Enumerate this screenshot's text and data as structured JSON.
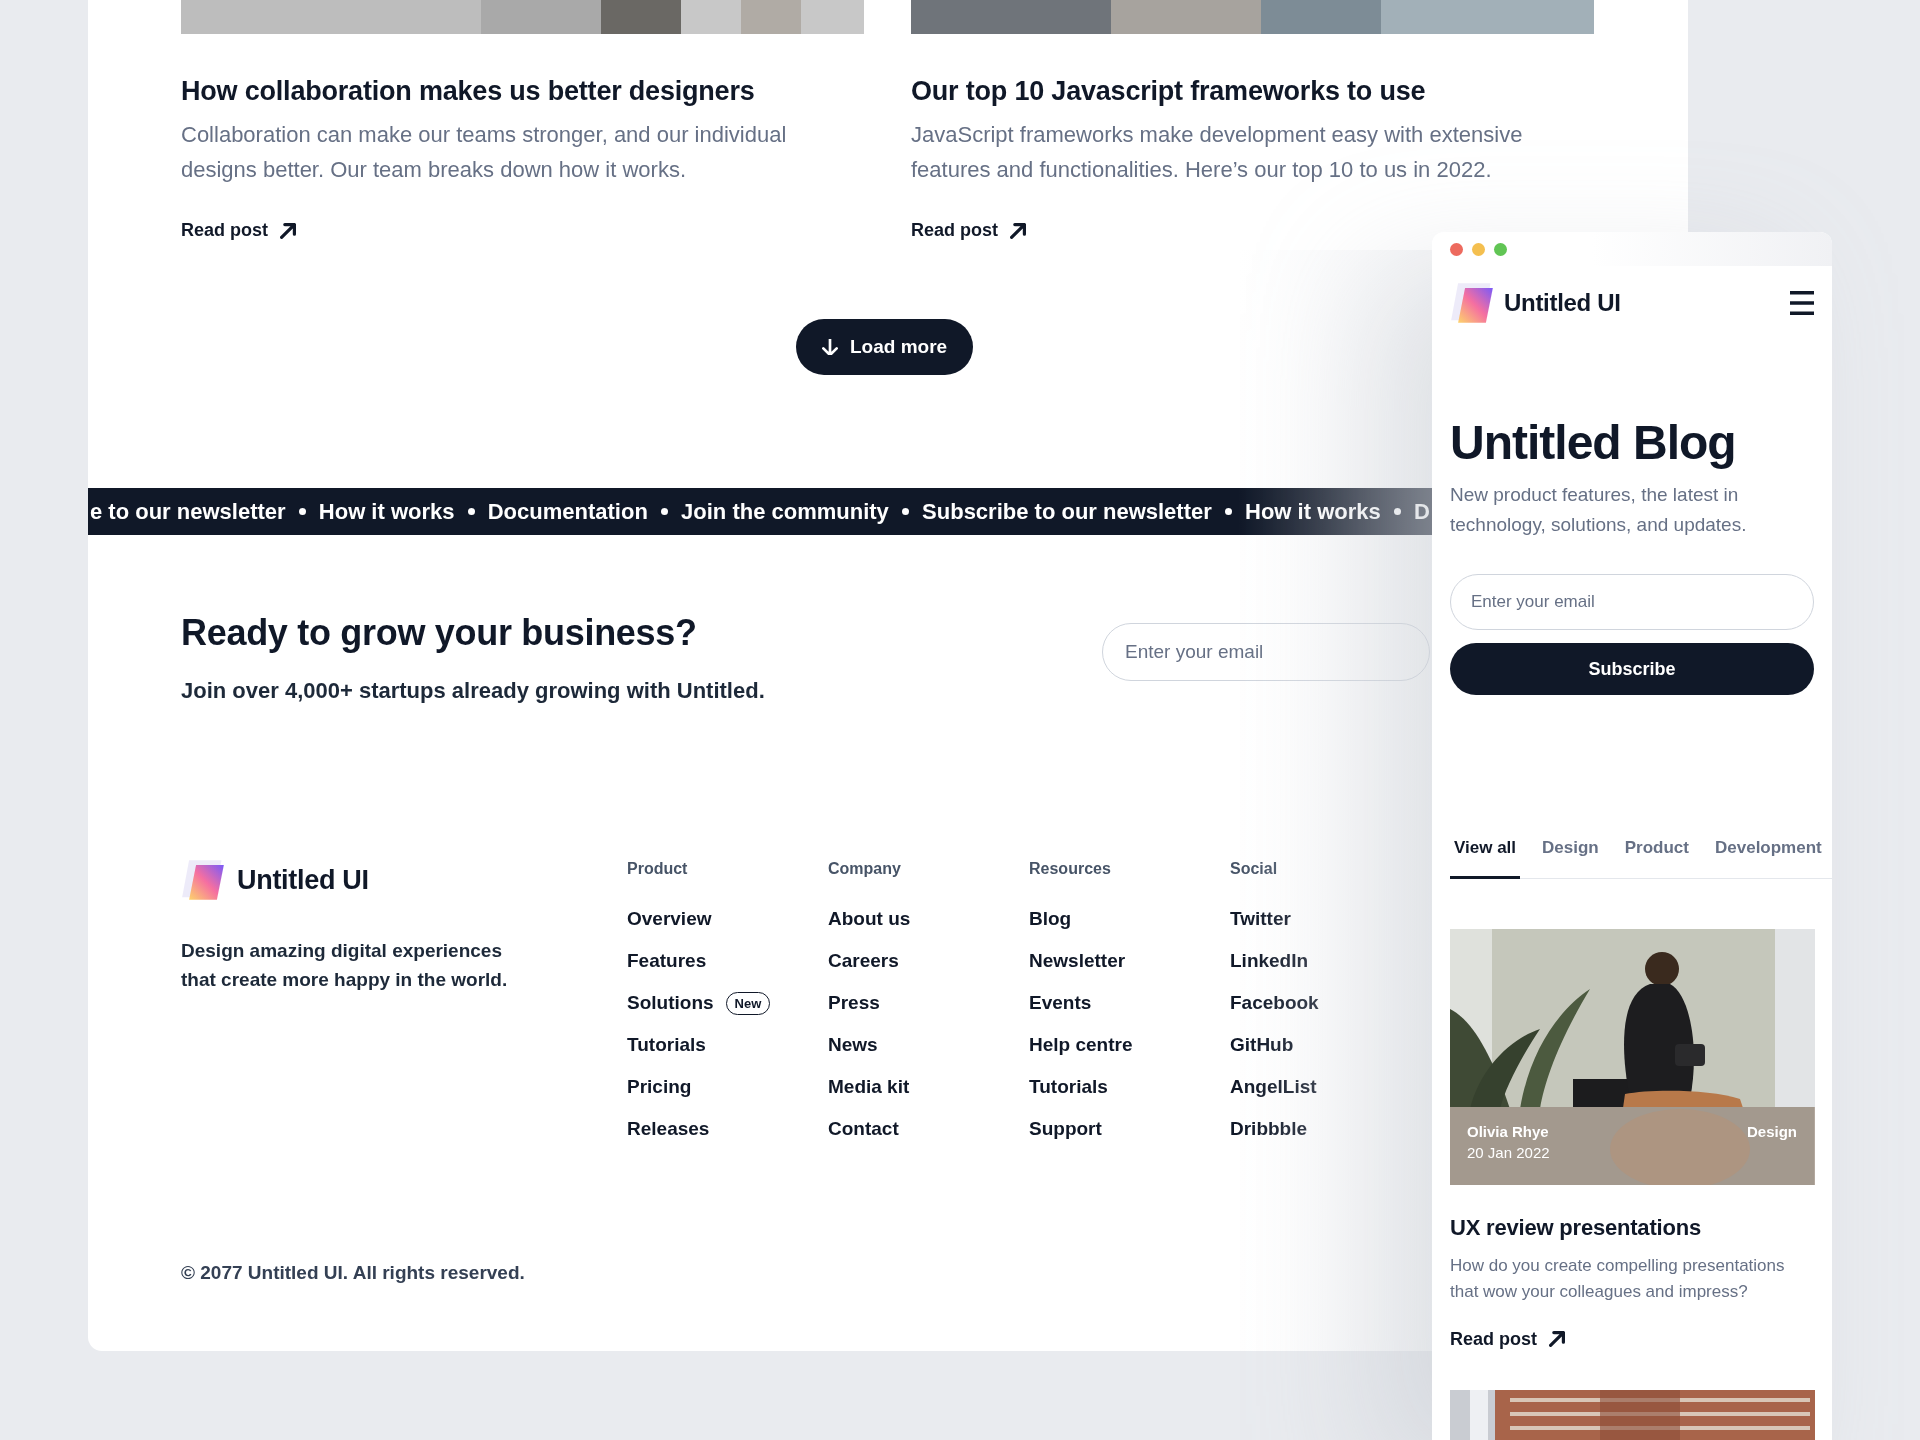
{
  "posts": [
    {
      "title": "How collaboration makes us better designers",
      "description": "Collaboration can make our teams stronger, and our individual designs better. Our team breaks down how it works.",
      "link": "Read post"
    },
    {
      "title": "Our top 10 Javascript frameworks to use",
      "description": "JavaScript frameworks make development easy with extensive features and functionalities. Here’s our top 10 to us in 2022.",
      "link": "Read post"
    }
  ],
  "load_more": "Load more",
  "ticker": [
    "e to our newsletter",
    "How it works",
    "Documentation",
    "Join the community",
    "Subscribe to our newsletter",
    "How it works",
    "D"
  ],
  "cta": {
    "heading": "Ready to grow your business?",
    "subtext": "Join over 4,000+ startups already growing with Untitled.",
    "placeholder": "Enter your email"
  },
  "footer": {
    "brand": "Untitled UI",
    "tagline": "Design amazing digital experiences that create more happy in the world.",
    "columns": [
      {
        "heading": "Product",
        "links": [
          {
            "label": "Overview"
          },
          {
            "label": "Features"
          },
          {
            "label": "Solutions",
            "badge": "New"
          },
          {
            "label": "Tutorials"
          },
          {
            "label": "Pricing"
          },
          {
            "label": "Releases"
          }
        ]
      },
      {
        "heading": "Company",
        "links": [
          {
            "label": "About us"
          },
          {
            "label": "Careers"
          },
          {
            "label": "Press"
          },
          {
            "label": "News"
          },
          {
            "label": "Media kit"
          },
          {
            "label": "Contact"
          }
        ]
      },
      {
        "heading": "Resources",
        "links": [
          {
            "label": "Blog"
          },
          {
            "label": "Newsletter"
          },
          {
            "label": "Events"
          },
          {
            "label": "Help centre"
          },
          {
            "label": "Tutorials"
          },
          {
            "label": "Support"
          }
        ]
      },
      {
        "heading": "Social",
        "links": [
          {
            "label": "Twitter"
          },
          {
            "label": "LinkedIn"
          },
          {
            "label": "Facebook"
          },
          {
            "label": "GitHub"
          },
          {
            "label": "AngelList"
          },
          {
            "label": "Dribbble"
          }
        ]
      }
    ],
    "copyright": "© 2077 Untitled UI. All rights reserved."
  },
  "mobile": {
    "brand": "Untitled UI",
    "title": "Untitled Blog",
    "description": "New product features, the latest in technology, solutions, and updates.",
    "placeholder": "Enter your email",
    "subscribe": "Subscribe",
    "tabs": [
      {
        "label": "View all",
        "selected": true
      },
      {
        "label": "Design",
        "selected": false
      },
      {
        "label": "Product",
        "selected": false
      },
      {
        "label": "Development",
        "selected": false
      }
    ],
    "post": {
      "author": "Olivia Rhye",
      "date": "20 Jan 2022",
      "category": "Design",
      "title": "UX review presentations",
      "description": "How do you create compelling presentations that wow your colleagues and impress?",
      "link": "Read post"
    }
  }
}
